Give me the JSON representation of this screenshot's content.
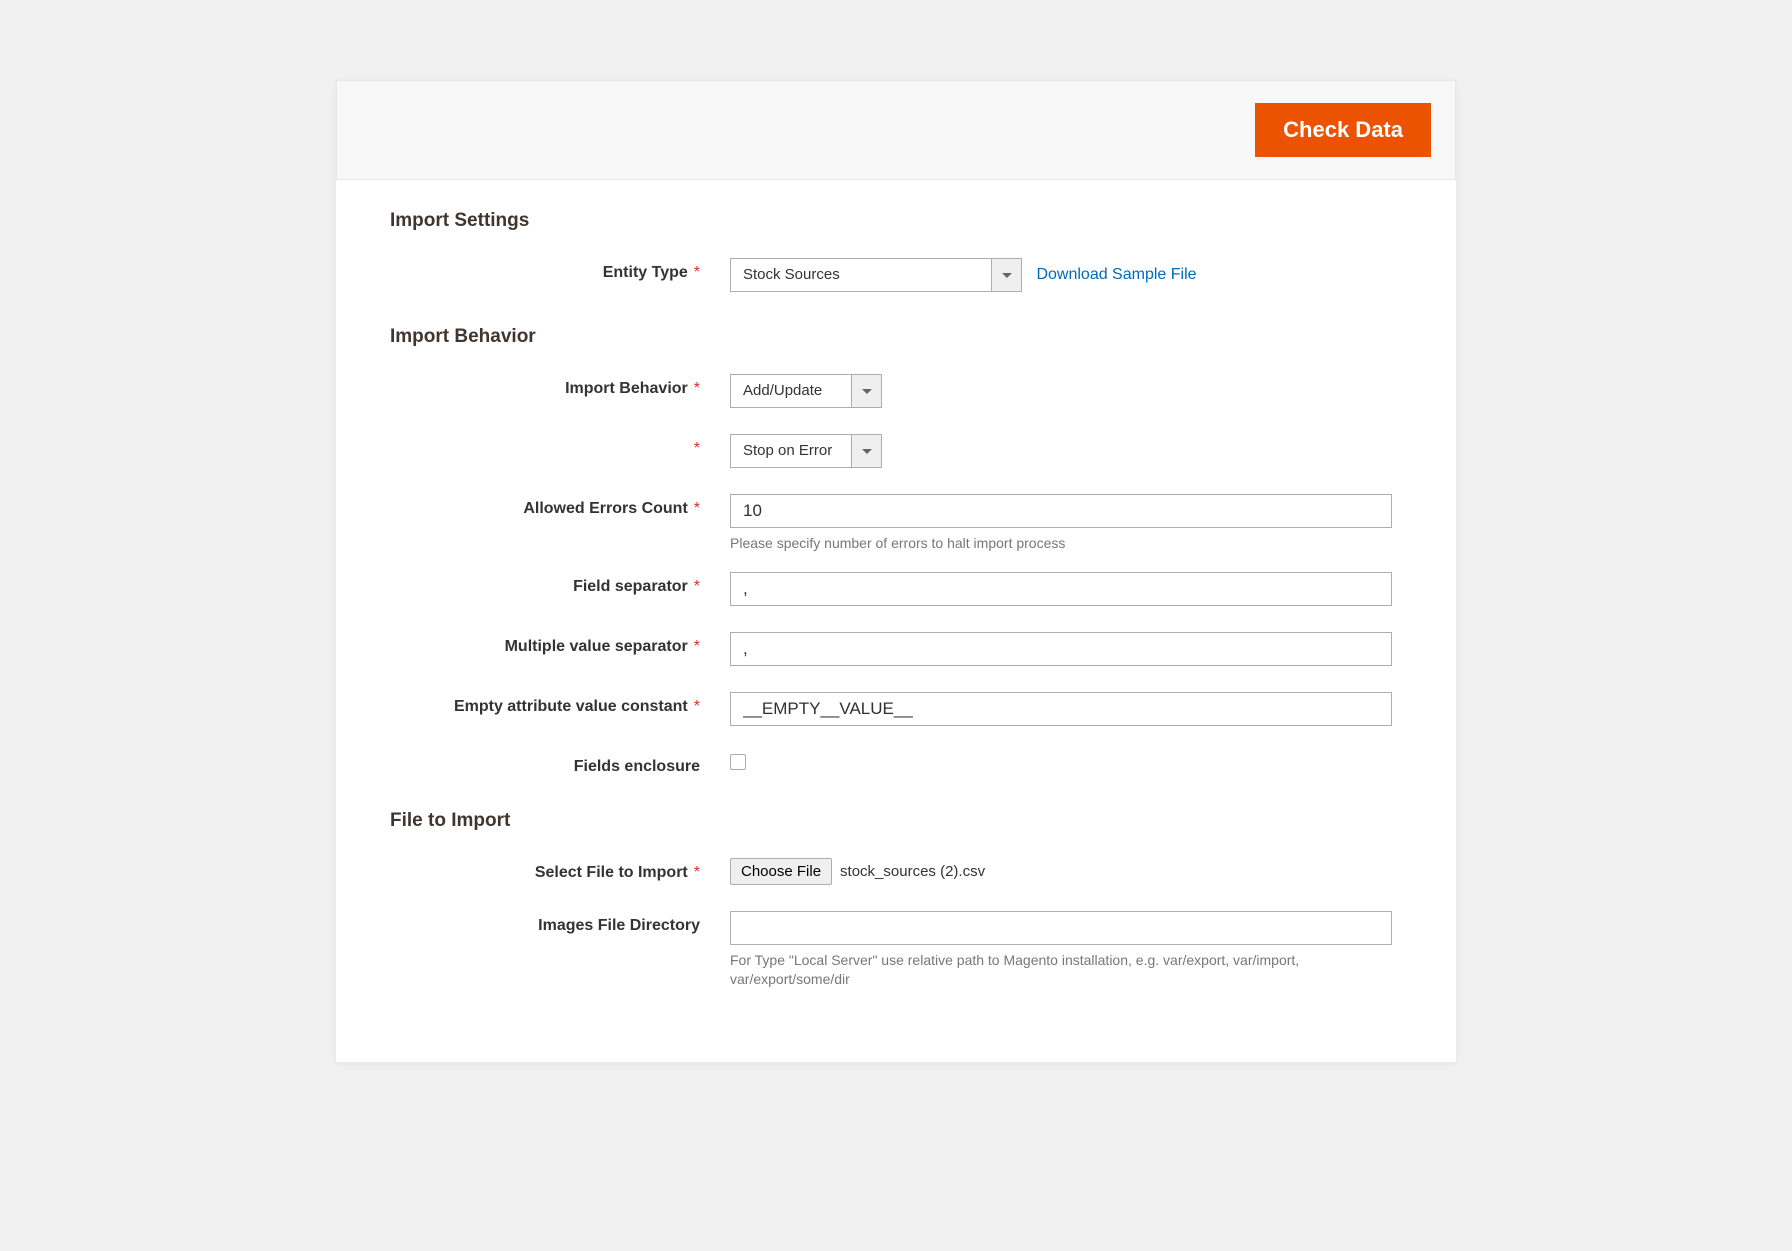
{
  "toolbar": {
    "check_data_label": "Check Data"
  },
  "sections": {
    "import_settings": {
      "title": "Import Settings",
      "entity_type": {
        "label": "Entity Type",
        "value": "Stock Sources",
        "download_link": "Download Sample File"
      }
    },
    "import_behavior": {
      "title": "Import Behavior",
      "behavior": {
        "label": "Import Behavior",
        "value": "Add/Update"
      },
      "validation": {
        "value": "Stop on Error"
      },
      "allowed_errors": {
        "label": "Allowed Errors Count",
        "value": "10",
        "hint": "Please specify number of errors to halt import process"
      },
      "field_separator": {
        "label": "Field separator",
        "value": ","
      },
      "multi_value_separator": {
        "label": "Multiple value separator",
        "value": ","
      },
      "empty_attr_constant": {
        "label": "Empty attribute value constant",
        "value": "__EMPTY__VALUE__"
      },
      "fields_enclosure": {
        "label": "Fields enclosure"
      }
    },
    "file_to_import": {
      "title": "File to Import",
      "select_file": {
        "label": "Select File to Import",
        "button": "Choose File",
        "filename": "stock_sources (2).csv"
      },
      "images_dir": {
        "label": "Images File Directory",
        "value": "",
        "hint": "For Type \"Local Server\" use relative path to Magento installation, e.g. var/export, var/import, var/export/some/dir"
      }
    }
  }
}
